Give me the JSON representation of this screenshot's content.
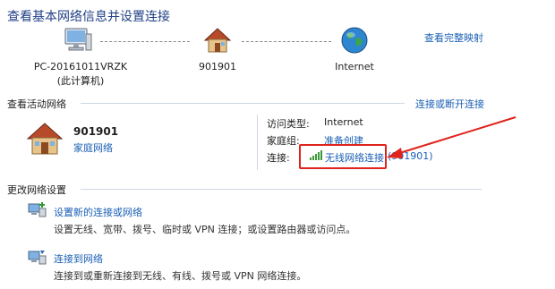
{
  "header": {
    "title": "查看基本网络信息并设置连接",
    "full_map_link": "查看完整映射"
  },
  "network_map": {
    "nodes": [
      {
        "label": "PC-20161011VRZK",
        "sublabel": "(此计算机)",
        "icon": "computer-icon"
      },
      {
        "label": "901901",
        "sublabel": "",
        "icon": "house-icon"
      },
      {
        "label": "Internet",
        "sublabel": "",
        "icon": "globe-icon"
      }
    ]
  },
  "active_networks": {
    "section_title": "查看活动网络",
    "connect_link": "连接或断开连接",
    "network_name": "901901",
    "network_type": "家庭网络",
    "access_type_label": "访问类型:",
    "access_type_value": "Internet",
    "homegroup_label": "家庭组:",
    "homegroup_value": "准备创建",
    "connection_label": "连接:",
    "connection_value": "无线网络连接",
    "connection_ssid": "(901901)"
  },
  "change_settings": {
    "section_title": "更改网络设置",
    "items": [
      {
        "link": "设置新的连接或网络",
        "desc": "设置无线、宽带、拨号、临时或 VPN 连接；或设置路由器或访问点。"
      },
      {
        "link": "连接到网络",
        "desc": "连接到或重新连接到无线、有线、拨号或 VPN 网络连接。"
      }
    ]
  },
  "colors": {
    "accent": "#1a5fb4",
    "annotation": "#e0231c"
  }
}
